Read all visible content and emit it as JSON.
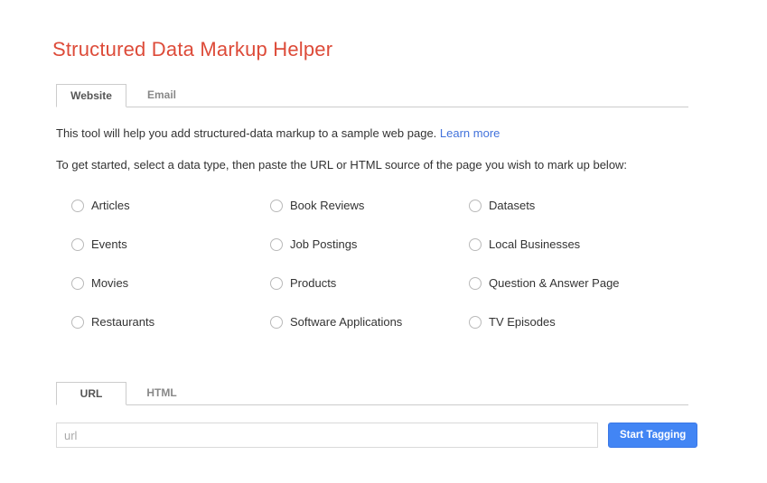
{
  "header": {
    "title": "Structured Data Markup Helper"
  },
  "main_tabs": {
    "website": {
      "label": "Website",
      "active": true
    },
    "email": {
      "label": "Email",
      "active": false
    }
  },
  "intro": {
    "text": "This tool will help you add structured-data markup to a sample web page.",
    "link_label": "Learn more",
    "instruction": "To get started, select a data type, then paste the URL or HTML source of the page you wish to mark up below:"
  },
  "data_types": [
    "Articles",
    "Book Reviews",
    "Datasets",
    "Events",
    "Job Postings",
    "Local Businesses",
    "Movies",
    "Products",
    "Question & Answer Page",
    "Restaurants",
    "Software Applications",
    "TV Episodes"
  ],
  "source_tabs": {
    "url": {
      "label": "URL",
      "active": true
    },
    "html": {
      "label": "HTML",
      "active": false
    }
  },
  "url_input": {
    "value": "",
    "placeholder": "url"
  },
  "actions": {
    "start_tagging_label": "Start Tagging"
  },
  "colors": {
    "title_red": "#dd4b39",
    "link_blue": "#4272db",
    "button_blue": "#4285f4",
    "tab_border": "#cccccc"
  }
}
